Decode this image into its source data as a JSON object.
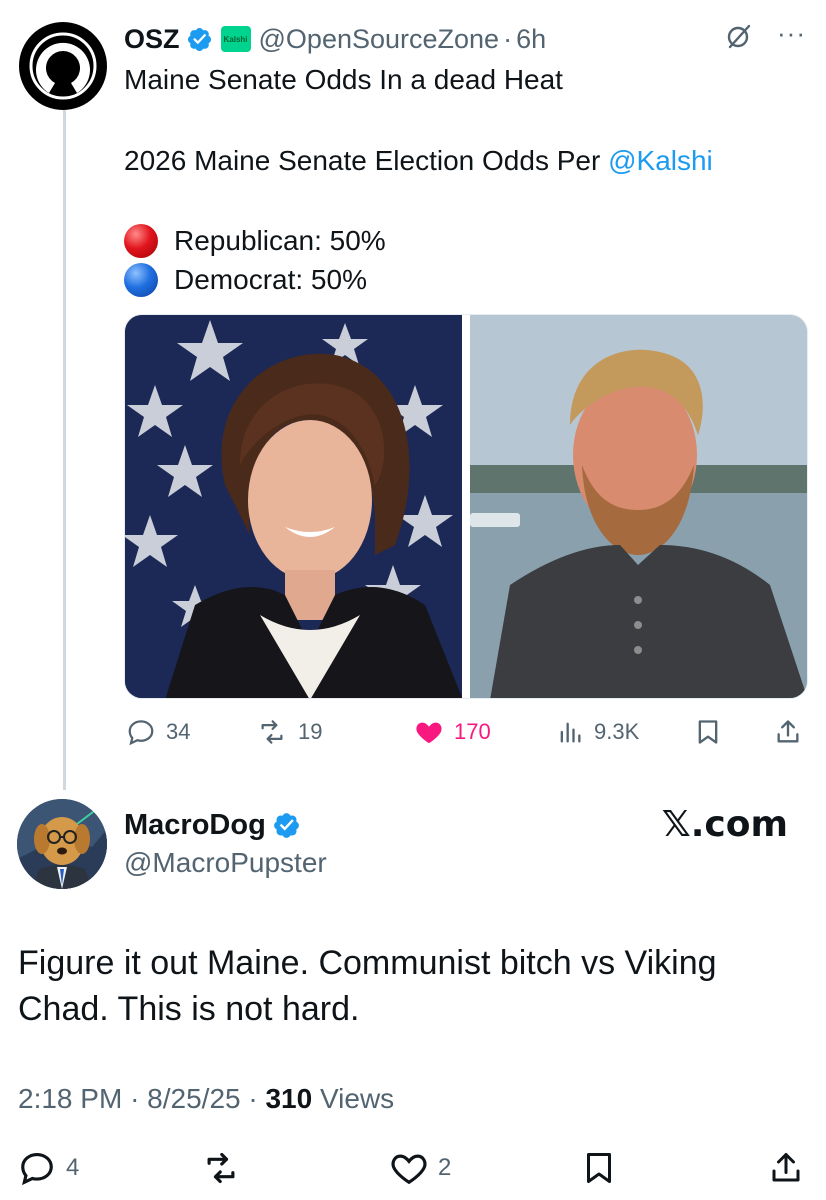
{
  "tweet1": {
    "display_name": "OSZ",
    "badge_label": "Kalshi",
    "handle": "@OpenSourceZone",
    "separator": "·",
    "time": "6h",
    "more": "···",
    "title_line": "Maine Senate Odds In a dead Heat",
    "odds_line_prefix": "2026 Maine Senate Election Odds Per ",
    "odds_line_link": "@Kalshi",
    "odds": [
      {
        "label": "Republican: 50%",
        "color": "#e0151d"
      },
      {
        "label": "Democrat: 50%",
        "color": "#1f6fe0"
      }
    ],
    "actions": {
      "replies": "34",
      "reposts": "19",
      "likes": "170",
      "views": "9.3K"
    }
  },
  "tweet2": {
    "display_name": "MacroDog",
    "handle": "@MacroPupster",
    "watermark": "𝕏.com",
    "text": "Figure it out Maine. Communist bitch vs Viking Chad. This is not hard.",
    "time": "2:18 PM",
    "date": "8/25/25",
    "separator": "·",
    "views_count": "310",
    "views_label": "Views",
    "actions": {
      "replies": "4",
      "likes": "2"
    }
  },
  "colors": {
    "link": "#1d9bf0",
    "verified": "#1d9bf0",
    "like": "#f91880",
    "muted": "#536471",
    "kalshi_badge": "#00d38e"
  }
}
